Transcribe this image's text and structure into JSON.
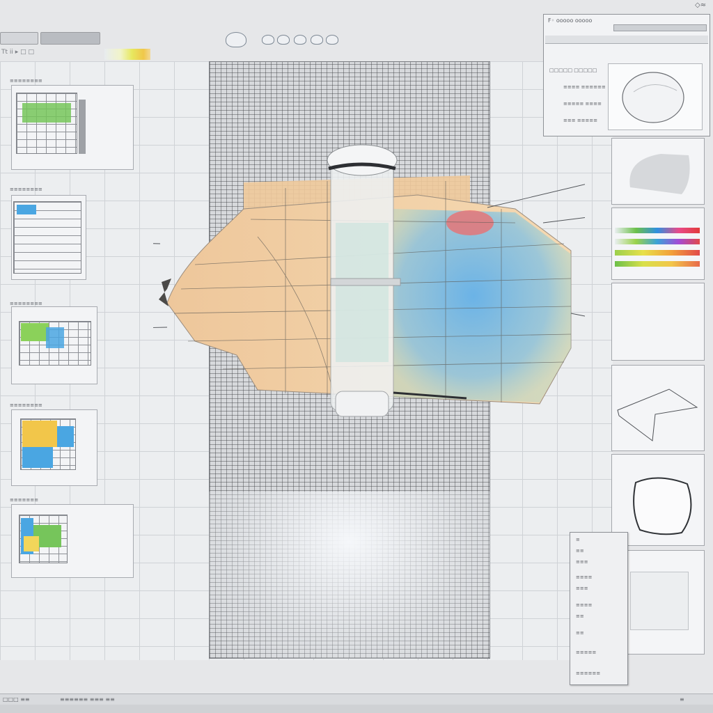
{
  "toolbar": {
    "tab_label": "",
    "row_label": "Tt  ii    ▸  □  □"
  },
  "properties_panel": {
    "title": "F◦  ooooo  ooooo",
    "rows": [
      "□□□□□  □□□□□",
      "≡≡≡≡  ≡≡≡≡≡≡",
      "≡≡≡≡≡  ≡≡≡≡",
      "≡≡≡  ≡≡≡≡≡"
    ]
  },
  "corner_label": "◇≈",
  "left_panels": [
    {
      "title": "≡≡≡≡≡≡≡≡"
    },
    {
      "title": "≡≡≡≡≡≡≡≡"
    },
    {
      "title": "≡≡≡≡≡≡≡≡"
    },
    {
      "title": "≡≡≡≡≡≡≡≡"
    },
    {
      "title": "≡≡≡≡≡≡≡"
    }
  ],
  "menu": {
    "items": [
      "≡",
      "≡≡",
      "≡≡≡",
      "≡≡≡≡",
      "≡≡≡",
      "≡≡≡≡",
      "≡≡",
      "≡≡",
      "≡≡≡≡≡",
      "≡≡≡≡≡≡"
    ]
  },
  "status": {
    "left": "□□□ ≡≡",
    "mid": "≡≡≡≡≡≡ ≡≡≡  ≡≡",
    "right": "≡"
  },
  "colors": {
    "model_skin": "#f1cfa4",
    "model_blue": "#6cb6e6",
    "model_teal": "#9fd0c5",
    "accent_red": "#ef6b6b",
    "thumb_green": "#76c55b",
    "thumb_blue": "#4aa6e2",
    "thumb_yellow": "#f2c64a"
  }
}
